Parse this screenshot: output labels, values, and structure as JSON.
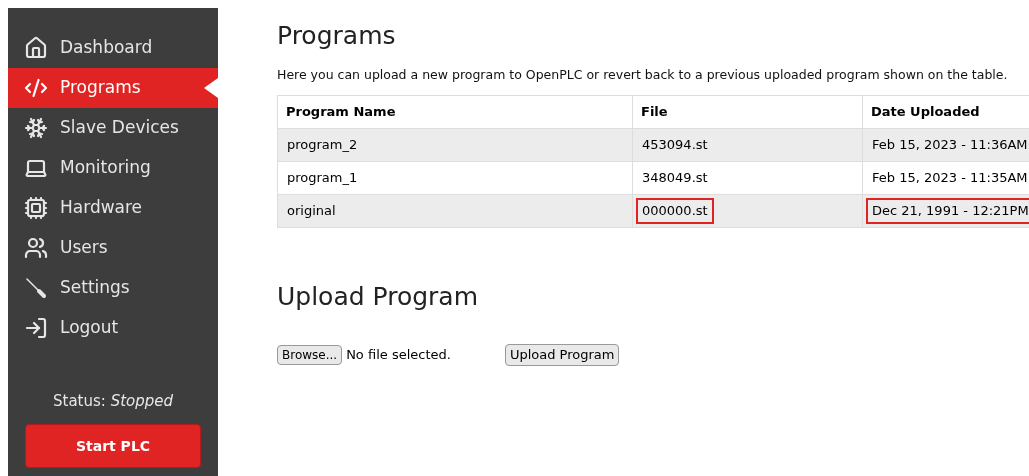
{
  "sidebar": {
    "items": [
      {
        "label": "Dashboard",
        "selected": false
      },
      {
        "label": "Programs",
        "selected": true
      },
      {
        "label": "Slave Devices",
        "selected": false
      },
      {
        "label": "Monitoring",
        "selected": false
      },
      {
        "label": "Hardware",
        "selected": false
      },
      {
        "label": "Users",
        "selected": false
      },
      {
        "label": "Settings",
        "selected": false
      },
      {
        "label": "Logout",
        "selected": false
      }
    ],
    "status_label": "Status:",
    "status_value": "Stopped",
    "start_button": "Start PLC"
  },
  "programs": {
    "title": "Programs",
    "description": "Here you can upload a new program to OpenPLC or revert back to a previous uploaded program shown on the table.",
    "table": {
      "columns": [
        "Program Name",
        "File",
        "Date Uploaded"
      ],
      "rows": [
        {
          "cells": [
            {
              "text": "program_2",
              "highlighted": false
            },
            {
              "text": "453094.st",
              "highlighted": false
            },
            {
              "text": "Feb 15, 2023 - 11:36AM",
              "highlighted": false
            }
          ]
        },
        {
          "cells": [
            {
              "text": "program_1",
              "highlighted": false
            },
            {
              "text": "348049.st",
              "highlighted": false
            },
            {
              "text": "Feb 15, 2023 - 11:35AM",
              "highlighted": false
            }
          ]
        },
        {
          "cells": [
            {
              "text": "original",
              "highlighted": false
            },
            {
              "text": "000000.st",
              "highlighted": true
            },
            {
              "text": "Dec 21, 1991 - 12:21PM",
              "highlighted": true
            }
          ]
        }
      ]
    }
  },
  "upload": {
    "title": "Upload Program",
    "browse_button": "Browse...",
    "file_status": "No file selected.",
    "upload_button": "Upload Program"
  }
}
